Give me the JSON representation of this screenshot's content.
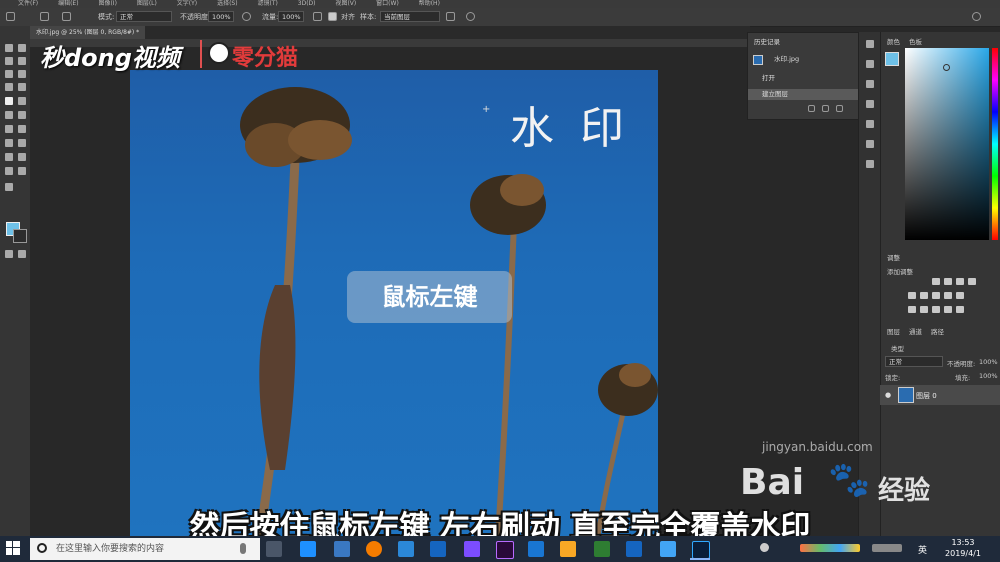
{
  "menubar": {
    "items": [
      "文件(F)",
      "编辑(E)",
      "图像(I)",
      "图层(L)",
      "文字(Y)",
      "选择(S)",
      "滤镜(T)",
      "3D(D)",
      "视图(V)",
      "窗口(W)",
      "帮助(H)"
    ]
  },
  "options": {
    "mode_label": "模式:",
    "mode_value": "正常",
    "opacity_label": "不透明度:",
    "opacity_value": "100%",
    "flow_label": "流量:",
    "flow_value": "100%",
    "align_label": "对齐",
    "sample_label": "样本:",
    "sample_value": "当前图层"
  },
  "document_tab": "水印.jpg @ 25% (图层 0, RGB/8#) *",
  "logo": {
    "left": "秒dong视频",
    "right": "零分猫"
  },
  "canvas": {
    "watermark_text": "水 印",
    "tooltip_text": "鼠标左键"
  },
  "history": {
    "title": "历史记录",
    "snapshot": "水印.jpg",
    "items": [
      "打开",
      "建立图层"
    ]
  },
  "right_panel": {
    "color_tab": "颜色",
    "swatches_tab": "色板",
    "adjust_tab": "调整",
    "adjust_add": "添加调整",
    "layers_tab": "图层",
    "channels_tab": "通道",
    "paths_tab": "路径",
    "kind_label": "类型",
    "blend_mode": "正常",
    "opacity_label": "不透明度:",
    "opacity_value": "100%",
    "lock_label": "锁定:",
    "fill_label": "填充:",
    "fill_value": "100%",
    "layer_name": "图层 0"
  },
  "subtitle": "然后按住鼠标左键 左右刷动 直至完全覆盖水印",
  "baidu": {
    "brand": "Bai",
    "sub": "经验",
    "url": "jingyan.baidu.com"
  },
  "taskbar": {
    "search_placeholder": "在这里输入你要搜索的内容",
    "lang": "英",
    "time": "13:53",
    "date": "2019/4/1"
  },
  "colors": {
    "accent_blue": "#1e6bb7",
    "foreground_swatch": "#6ec1e8",
    "logo_red": "#e23b3b"
  }
}
